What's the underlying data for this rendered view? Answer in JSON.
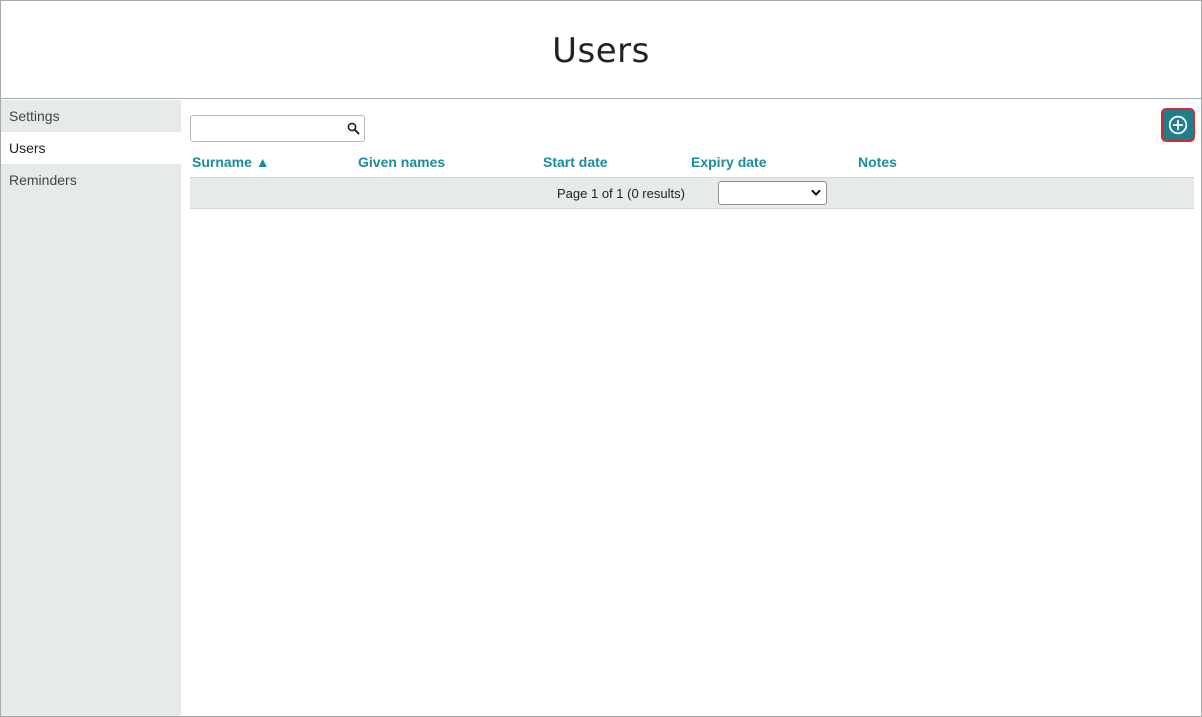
{
  "header": {
    "title": "Users"
  },
  "sidebar": {
    "items": [
      {
        "label": "Settings",
        "active": false
      },
      {
        "label": "Users",
        "active": true
      },
      {
        "label": "Reminders",
        "active": false
      }
    ]
  },
  "toolbar": {
    "search": {
      "value": "",
      "placeholder": ""
    },
    "add_icon": "plus-circle-icon"
  },
  "table": {
    "columns": [
      "Surname ▲",
      "Given names",
      "Start date",
      "Expiry date",
      "Notes"
    ],
    "rows": []
  },
  "pager": {
    "text": "Page 1 of 1 (0 results)",
    "select_value": ""
  },
  "colors": {
    "accent": "#1a8c9c",
    "add_button_bg": "#1f7d8c",
    "highlight_border": "#d62b2b",
    "sidebar_bg": "#e7eaea"
  }
}
